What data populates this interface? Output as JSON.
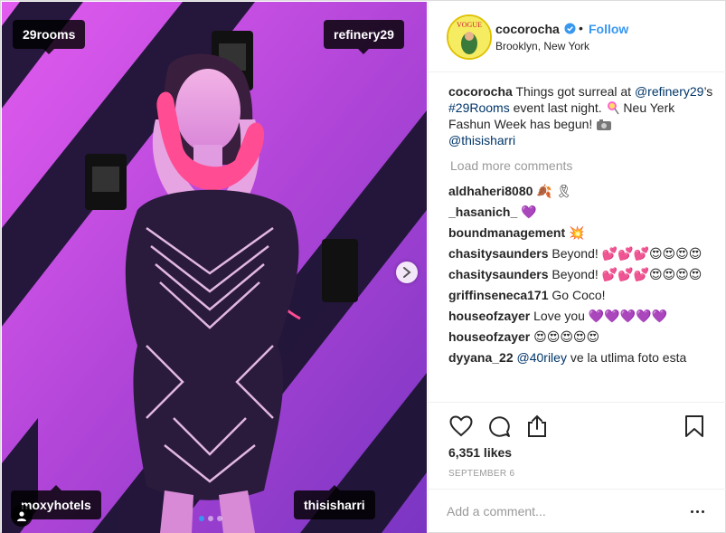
{
  "post": {
    "photo_tags": {
      "top_left": "29rooms",
      "top_right": "refinery29",
      "bottom_left": "moxyhotels",
      "bottom_right": "thisisharri"
    },
    "carousel": {
      "total": 3,
      "active_index": 0
    }
  },
  "header": {
    "avatar_text": "VOGUE",
    "username": "cocorocha",
    "separator": "•",
    "follow_label": "Follow",
    "location": "Brooklyn, New York"
  },
  "caption": {
    "username": "cocorocha",
    "t1": " Things got surreal at ",
    "m1": "@refinery29",
    "t2": "’s ",
    "m2": "#29Rooms",
    "t3": " event last night. ",
    "t4": " Neu Yerk Fashun Week has begun! ",
    "m3": "@thisisharri"
  },
  "load_more": "Load more comments",
  "comments": [
    {
      "user": "aldhaheri8080",
      "text": " ",
      "emoji": "🍂 🎗"
    },
    {
      "user": "_hasanich_",
      "text": " ",
      "emoji": "💜"
    },
    {
      "user": "boundmanagement",
      "text": " ",
      "emoji": "💥"
    },
    {
      "user": "chasitysaunders",
      "text": " Beyond! ",
      "emoji": "💕💕💕😍😍😍😍"
    },
    {
      "user": "chasitysaunders",
      "text": " Beyond! ",
      "emoji": "💕💕💕😍😍😍😍"
    },
    {
      "user": "griffinseneca171",
      "text": " Go Coco!",
      "emoji": ""
    },
    {
      "user": "houseofzayer",
      "text": " Love you ",
      "emoji": "💜💜💜💜💜"
    },
    {
      "user": "houseofzayer",
      "text": " ",
      "emoji": "😍😍😍😍😍"
    },
    {
      "user": "dyyana_22",
      "text": " ",
      "mention": "@40riley",
      "text2": " ve la utlima foto esta"
    }
  ],
  "likes": "6,351 likes",
  "date": "SEPTEMBER 6",
  "add_comment_placeholder": "Add a comment...",
  "colors": {
    "link_blue": "#3897f0",
    "mention": "#003569",
    "muted": "#999999"
  },
  "icons": [
    "heart-icon",
    "comment-icon",
    "share-icon",
    "bookmark-icon",
    "verified-badge-icon",
    "chevron-right-icon",
    "user-tag-icon",
    "more-options-icon",
    "lollipop-icon",
    "camera-icon"
  ]
}
